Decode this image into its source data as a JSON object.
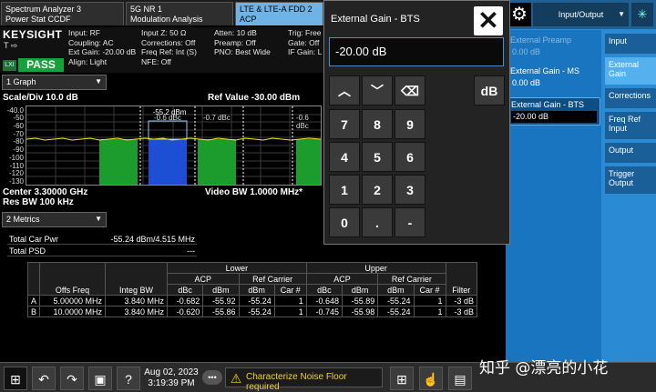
{
  "tabs": [
    {
      "line1": "Spectrum Analyzer 3",
      "line2": "Power Stat CCDF",
      "active": false
    },
    {
      "line1": "5G NR 1",
      "line2": "Modulation Analysis",
      "active": false
    },
    {
      "line1": "LTE & LTE-A FDD 2",
      "line2": "ACP",
      "active": true
    }
  ],
  "brand": "KEYSIGHT",
  "trig_symbols": "T ⇨",
  "lxi": "LXI",
  "pass": "PASS",
  "info": {
    "col1": [
      "Input: RF",
      "Coupling: AC",
      "Ext Gain: -20.00 dB",
      "Align: Light"
    ],
    "col2": [
      "Input Z: 50 Ω",
      "Corrections: Off",
      "Freq Ref: Int (S)",
      "NFE: Off"
    ],
    "col3": [
      "Atten: 10 dB",
      "Preamp: Off",
      "PNO: Best Wide"
    ],
    "col4": [
      "Trig: Free",
      "Gate: Off",
      "IF Gain: L"
    ]
  },
  "view1": "1 Graph",
  "graph": {
    "scale": "Scale/Div 10.0 dB",
    "ref_value": "Ref Value -30.00 dBm",
    "center": "Center 3.30000 GHz",
    "res_bw": "Res BW 100 kHz",
    "video_bw": "Video BW 1.0000 MHz*",
    "y_ticks": [
      "-40.0",
      "-50",
      "-60",
      "-70",
      "-80",
      "-90",
      "-100",
      "-110",
      "-120",
      "-130"
    ],
    "markers": [
      {
        "text": "-0.6 dBc"
      },
      {
        "text": "-0.7 dBc"
      },
      {
        "text": "-55.2 dBm"
      },
      {
        "text": "-0.6 dBc"
      }
    ]
  },
  "view2": "2 Metrics",
  "metrics": {
    "total_car_pwr_label": "Total Car Pwr",
    "total_car_pwr_value": "-55.24 dBm/4.515 MHz",
    "total_psd_label": "Total PSD",
    "total_psd_value": "---"
  },
  "acp_table": {
    "group_lower": "Lower",
    "group_upper": "Upper",
    "sub_acp": "ACP",
    "sub_ref": "Ref Carrier",
    "col_offs": "Offs Freq",
    "col_integ": "Integ BW",
    "col_dbc": "dBc",
    "col_dbm": "dBm",
    "col_car": "Car #",
    "col_filter": "Filter",
    "rows": [
      [
        "A",
        "5.00000 MHz",
        "3.840 MHz",
        "-0.682",
        "-55.92",
        "-55.24",
        "1",
        "-0.648",
        "-55.89",
        "-55.24",
        "1",
        "-3 dB"
      ],
      [
        "B",
        "10.0000 MHz",
        "3.840 MHz",
        "-0.620",
        "-55.86",
        "-55.24",
        "1",
        "-0.745",
        "-55.98",
        "-55.24",
        "1",
        "-3 dB"
      ]
    ]
  },
  "popup": {
    "title": "External Gain - BTS",
    "value": "-20.00 dB",
    "keys": [
      "7",
      "8",
      "9",
      "4",
      "5",
      "6",
      "1",
      "2",
      "3",
      "0",
      ".",
      "-"
    ],
    "unit": "dB"
  },
  "right_panel": {
    "title": "Input/Output",
    "items": [
      {
        "label": "External Preamp",
        "value": "0.00 dB",
        "state": "dim"
      },
      {
        "label": "External Gain - MS",
        "value": "0.00 dB",
        "state": "normal"
      },
      {
        "label": "External Gain - BTS",
        "value": "-20.00 dB",
        "state": "on"
      }
    ],
    "tabs": [
      "Input",
      "External Gain",
      "Corrections",
      "Freq Ref Input",
      "Output",
      "Trigger Output"
    ]
  },
  "taskbar": {
    "date": "Aug 02, 2023",
    "time": "3:19:39 PM",
    "warning": "Characterize Noise Floor required"
  },
  "watermark": "知乎 @漂亮的小花"
}
